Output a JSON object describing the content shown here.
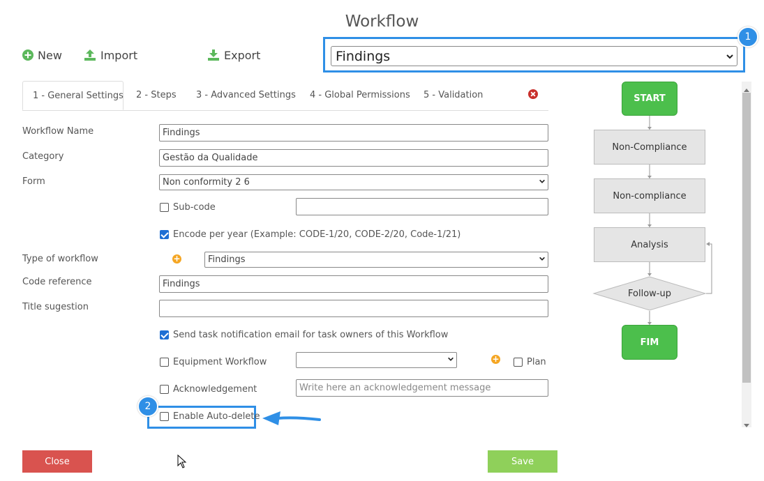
{
  "dialog": {
    "title": "Workflow"
  },
  "toolbar": {
    "new_label": "New",
    "import_label": "Import",
    "export_label": "Export"
  },
  "workflow_select": {
    "value": "Findings"
  },
  "callouts": {
    "one": "1",
    "two": "2"
  },
  "tabs": [
    {
      "label": "1 - General Settings",
      "active": true
    },
    {
      "label": "2 - Steps"
    },
    {
      "label": "3 - Advanced Settings"
    },
    {
      "label": "4 - Global Permissions"
    },
    {
      "label": "5 - Validation"
    }
  ],
  "form": {
    "workflow_name": {
      "label": "Workflow Name",
      "value": "Findings"
    },
    "category": {
      "label": "Category",
      "value": "Gestão da Qualidade"
    },
    "form": {
      "label": "Form",
      "value": "Non conformity 2 6"
    },
    "sub_code": {
      "label": "Sub-code",
      "checked": false,
      "value": ""
    },
    "encode_per_year": {
      "label": "Encode per year (Example: CODE-1/20, CODE-2/20, Code-1/21)",
      "checked": true
    },
    "type_of_workflow": {
      "label": "Type of workflow",
      "value": "Findings"
    },
    "code_reference": {
      "label": "Code reference",
      "value": "Findings"
    },
    "title_suggestion": {
      "label": "Title sugestion",
      "value": ""
    },
    "send_notification": {
      "label": "Send task notification email for task owners of this Workflow",
      "checked": true
    },
    "equipment_workflow": {
      "label": "Equipment Workflow",
      "checked": false,
      "value": ""
    },
    "plan": {
      "label": "Plan",
      "checked": false
    },
    "acknowledgement": {
      "label": "Acknowledgement",
      "checked": false,
      "placeholder": "Write here an acknowledgement message"
    },
    "auto_delete": {
      "label": "Enable Auto-delete",
      "checked": false
    }
  },
  "flow": {
    "start": "START",
    "steps": [
      "Non-Compliance",
      "Non-compliance",
      "Analysis"
    ],
    "decision": "Follow-up",
    "end": "FIM"
  },
  "footer": {
    "close_label": "Close",
    "save_label": "Save"
  },
  "colors": {
    "accent_blue": "#2f8fe6",
    "close_red": "#d9534f",
    "save_green": "#8fd05a",
    "terminal_green": "#4cbf4c",
    "warning_orange": "#f5a623"
  }
}
